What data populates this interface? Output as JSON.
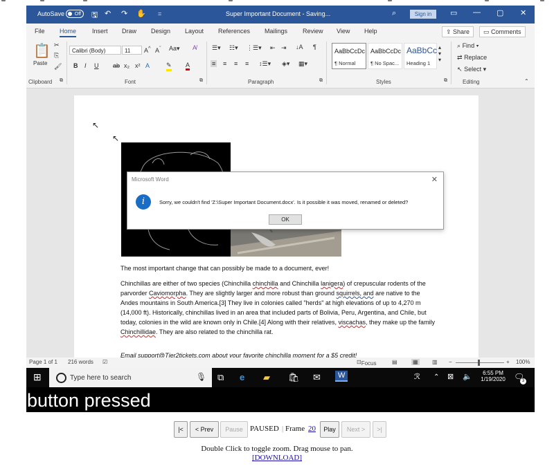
{
  "window": {
    "autosave_label": "AutoSave",
    "autosave_state": "Off",
    "title": "Super Important Document - Saving...",
    "signin_label": "Sign in",
    "min_glyph": "—",
    "max_glyph": "▢",
    "close_glyph": "✕"
  },
  "tabs": [
    "File",
    "Home",
    "Insert",
    "Draw",
    "Design",
    "Layout",
    "References",
    "Mailings",
    "Review",
    "View",
    "Help"
  ],
  "share_label": "Share",
  "comments_label": "Comments",
  "ribbon": {
    "paste_label": "Paste",
    "font_name": "Calibri (Body)",
    "font_size": "11",
    "groups": [
      "Clipboard",
      "Font",
      "Paragraph",
      "Styles",
      "Editing"
    ],
    "styles": [
      {
        "preview": "AaBbCcDc",
        "name": "¶ Normal"
      },
      {
        "preview": "AaBbCcDc",
        "name": "¶ No Spac..."
      },
      {
        "preview": "AaBbCc",
        "name": "Heading 1"
      }
    ],
    "find_label": "Find",
    "replace_label": "Replace",
    "select_label": "Select"
  },
  "document": {
    "heading": "The most important change that can possibly be made to a document, ever!",
    "p1": [
      "Chinchillas are either of two species (Chinchilla ",
      "chinchilla",
      " and Chinchilla ",
      "lanigera",
      ") of crepuscular rodents of the parvorder ",
      "Caviomorpha",
      ". They are slightly larger and more robust than ground ",
      "squirrels, and",
      " are native to the Andes mountains in South America.[3] They live in colonies called \"herds\" at high elevations of up to 4,270 m (14,000 ft). Historically, chinchillas lived in an area that included parts of Bolivia, Peru, Argentina, and Chile, but today, colonies in the wild are known only in Chile.[4] Along with their relatives, ",
      "viscachas",
      ", they make up the family ",
      "Chinchillidae",
      ". They are also related to the chinchilla rat."
    ],
    "p2": "Email support@Tier2tickets.com about your favorite chinchilla moment for a $5 credit!"
  },
  "dialog": {
    "title": "Microsoft Word",
    "message": "Sorry, we couldn't find 'Z:\\Super Important Document.docx'. Is it possible it was moved, renamed or deleted?",
    "ok_label": "OK"
  },
  "statusbar": {
    "page": "Page 1 of 1",
    "words": "216 words",
    "focus": "Focus",
    "zoom": "100%"
  },
  "taskbar": {
    "search_placeholder": "Type here to search",
    "time": "6:55 PM",
    "date": "1/19/2020",
    "notif_count": "3"
  },
  "overlay_text": "button pressed",
  "player": {
    "first": "|<",
    "prev": "< Prev",
    "pause": "Pause",
    "state": "PAUSED",
    "frame_label": "Frame",
    "frame": "20",
    "play": "Play",
    "next": "Next >",
    "last": ">|"
  },
  "help_text": "Double Click to toggle zoom. Drag mouse to pan.",
  "download_label": "[DOWNLOAD]",
  "colors": {
    "word_blue": "#2b579a",
    "taskbar": "#0a0a0a",
    "info_blue": "#1a6dc4"
  }
}
